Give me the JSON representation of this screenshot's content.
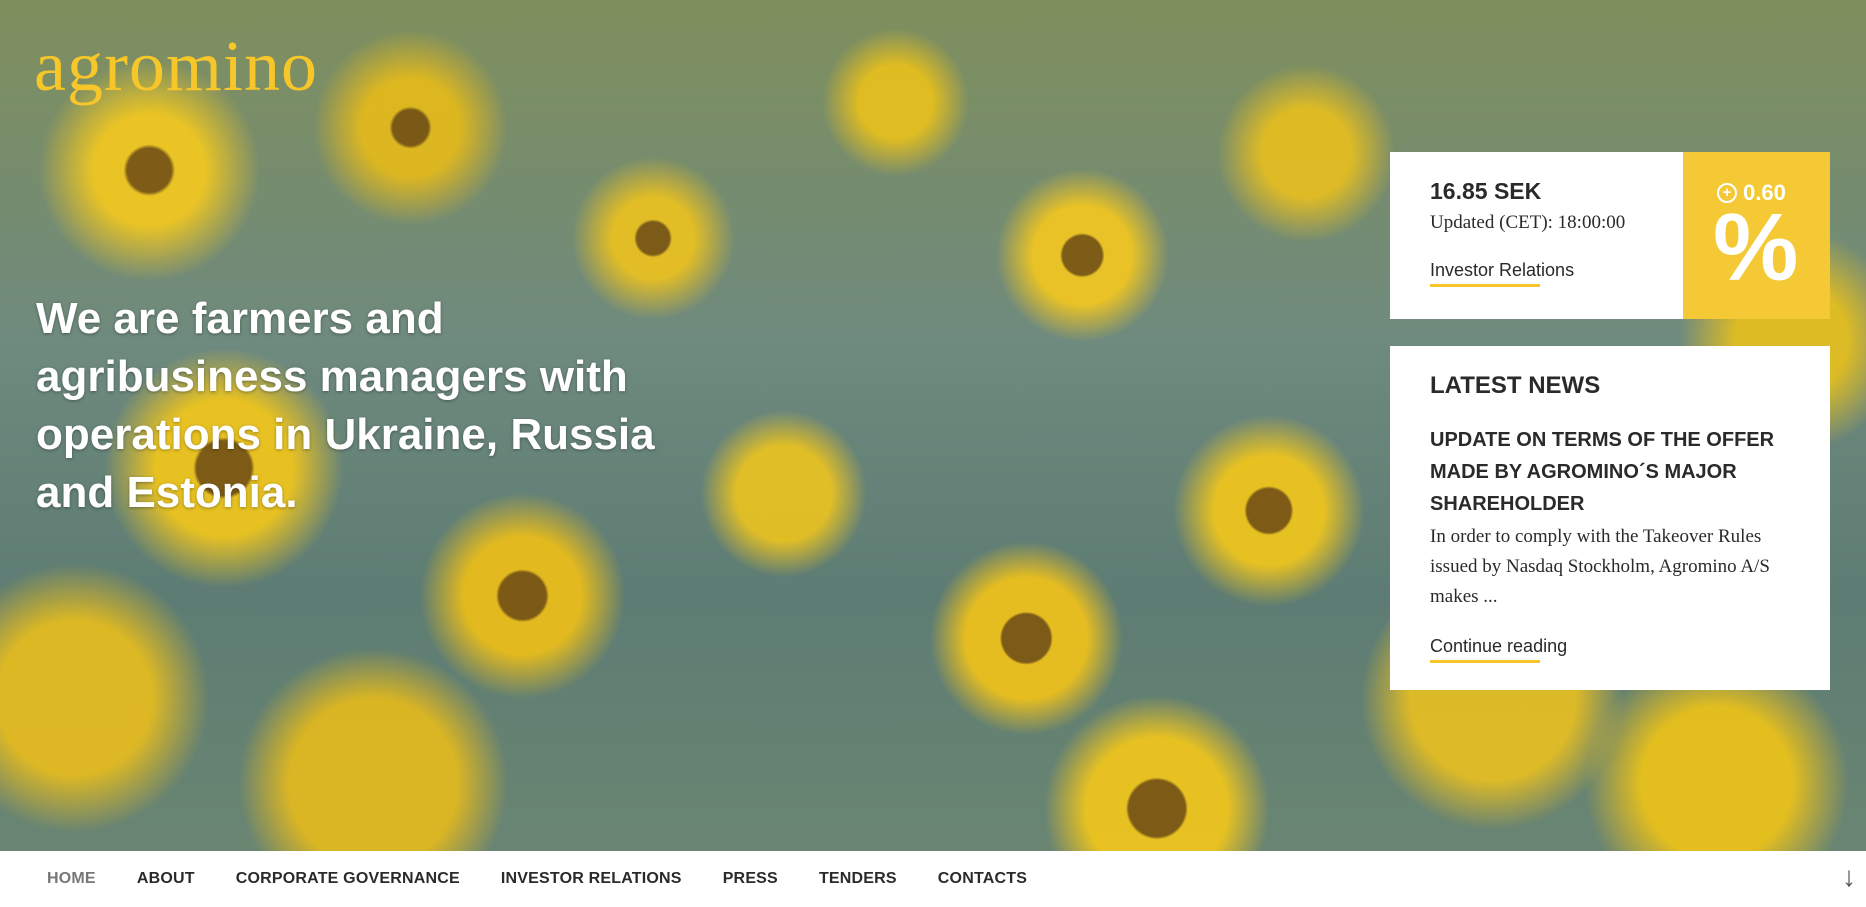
{
  "brand": {
    "logo_text": "agromino",
    "accent": "#f6c62a"
  },
  "hero": {
    "tagline": "We are farmers and agribusiness managers with operations in Ukraine, Russia and Estonia."
  },
  "stock": {
    "price": "16.85 SEK",
    "updated": "Updated (CET): 18:00:00",
    "link_label": "Investor Relations",
    "change": "0.60",
    "change_symbol": "%",
    "change_icon": "plus-circle-icon",
    "change_box_color": "#f4c935"
  },
  "news": {
    "heading": "LATEST NEWS",
    "title": "UPDATE ON TERMS OF THE OFFER MADE BY AGROMINO´S MAJOR SHAREHOLDER",
    "excerpt": "In order to comply with the Takeover Rules issued by Nasdaq Stockholm, Agromino A/S makes ...",
    "link_label": "Continue reading"
  },
  "nav": {
    "items": [
      {
        "label": "HOME",
        "active": true
      },
      {
        "label": "ABOUT"
      },
      {
        "label": "CORPORATE GOVERNANCE"
      },
      {
        "label": "INVESTOR RELATIONS"
      },
      {
        "label": "PRESS"
      },
      {
        "label": "TENDERS"
      },
      {
        "label": "CONTACTS"
      }
    ],
    "scroll_icon": "down-arrow-icon"
  }
}
